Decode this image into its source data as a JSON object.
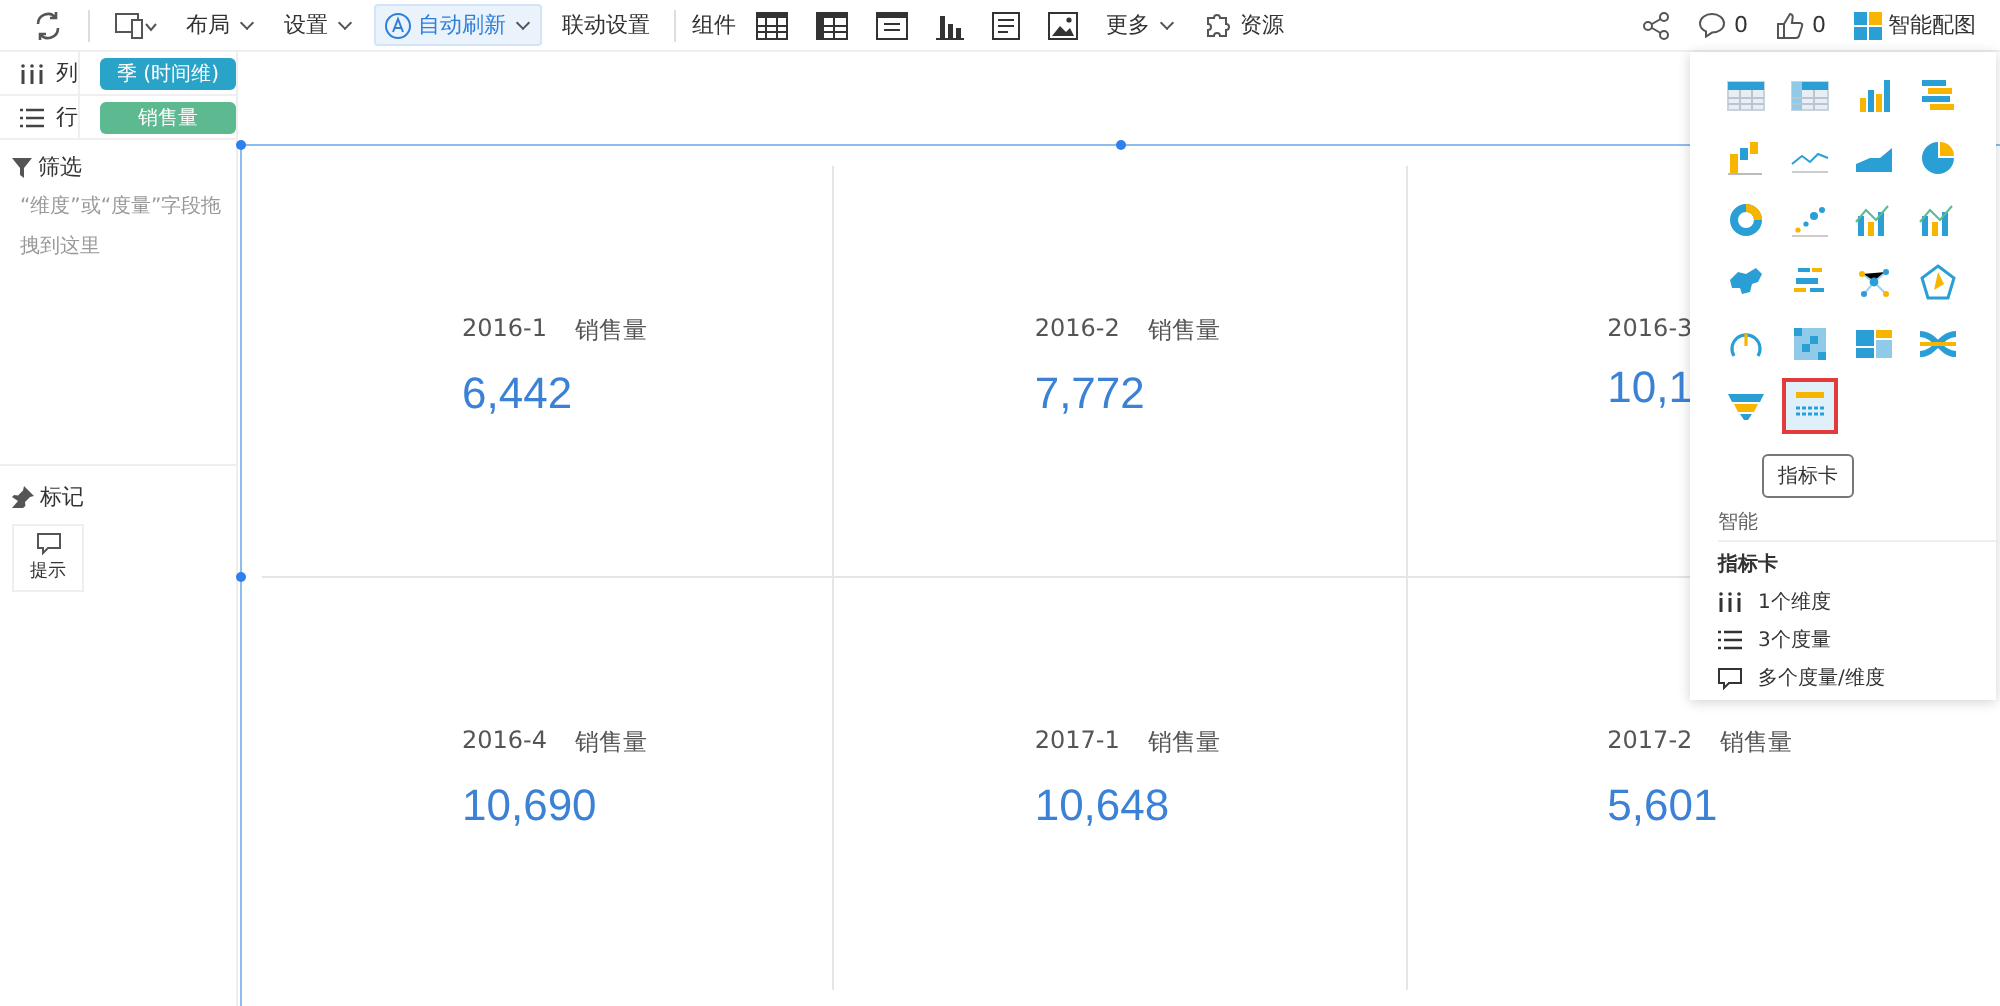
{
  "toolbar": {
    "menus": [
      {
        "kind": "device"
      },
      {
        "kind": "text",
        "label": "布局"
      },
      {
        "kind": "text",
        "label": "设置"
      }
    ],
    "auto_refresh": {
      "label": "自动刷新",
      "selected": true
    },
    "link_settings": "联动设置",
    "components_label": "组件",
    "more": "更多",
    "resources": "资源",
    "comments": "0",
    "likes": "0",
    "smart_chart": "智能配图"
  },
  "shelves": [
    {
      "kind": "column",
      "label": "列",
      "pill": "季 (时间维)",
      "color": "#2aa3c9"
    },
    {
      "kind": "row",
      "label": "行",
      "pill": "销售量",
      "color": "#5cb990"
    }
  ],
  "filter": {
    "title": "筛选",
    "hint": "“维度”或“度量”字段拖拽到这里"
  },
  "marks": {
    "title": "标记",
    "button": "提示"
  },
  "cards": [
    {
      "period": "2016-1",
      "measure": "销售量",
      "value": "6,442"
    },
    {
      "period": "2016-2",
      "measure": "销售量",
      "value": "7,772"
    },
    {
      "period": "2016-3",
      "value": "10,1"
    },
    {
      "period": "2016-4",
      "measure": "销售量",
      "value": "10,690"
    },
    {
      "period": "2017-1",
      "measure": "销售量",
      "value": "10,648"
    },
    {
      "period": "2017-2",
      "measure": "销售量",
      "value": "5,601"
    }
  ],
  "chart_panel": {
    "types": [
      {
        "kind": "table",
        "selected": false
      },
      {
        "kind": "crosstable",
        "selected": false
      },
      {
        "kind": "bar",
        "selected": false
      },
      {
        "kind": "hbar",
        "selected": false
      },
      {
        "kind": "waterfall",
        "selected": false
      },
      {
        "kind": "line",
        "selected": false
      },
      {
        "kind": "area",
        "selected": false
      },
      {
        "kind": "pie",
        "selected": false
      },
      {
        "kind": "donut",
        "selected": false
      },
      {
        "kind": "scatter",
        "selected": false
      },
      {
        "kind": "combo",
        "selected": false
      },
      {
        "kind": "combo",
        "selected": false
      },
      {
        "kind": "map",
        "selected": false
      },
      {
        "kind": "wordcloud",
        "selected": false
      },
      {
        "kind": "network",
        "selected": false
      },
      {
        "kind": "radar",
        "selected": false
      },
      {
        "kind": "gauge",
        "selected": false
      },
      {
        "kind": "heatmap",
        "selected": false
      },
      {
        "kind": "treemap",
        "selected": false
      },
      {
        "kind": "flow",
        "selected": false
      },
      {
        "kind": "funnel",
        "selected": false
      },
      {
        "kind": "kpi",
        "selected": true
      }
    ],
    "tooltip": "指标卡",
    "heading": "智能",
    "subtitle": "指标卡",
    "requirements": [
      {
        "kind": "dimension",
        "text": "1个维度"
      },
      {
        "kind": "measure",
        "text": "3个度量"
      },
      {
        "kind": "tip",
        "text": "多个度量/维度"
      }
    ]
  }
}
